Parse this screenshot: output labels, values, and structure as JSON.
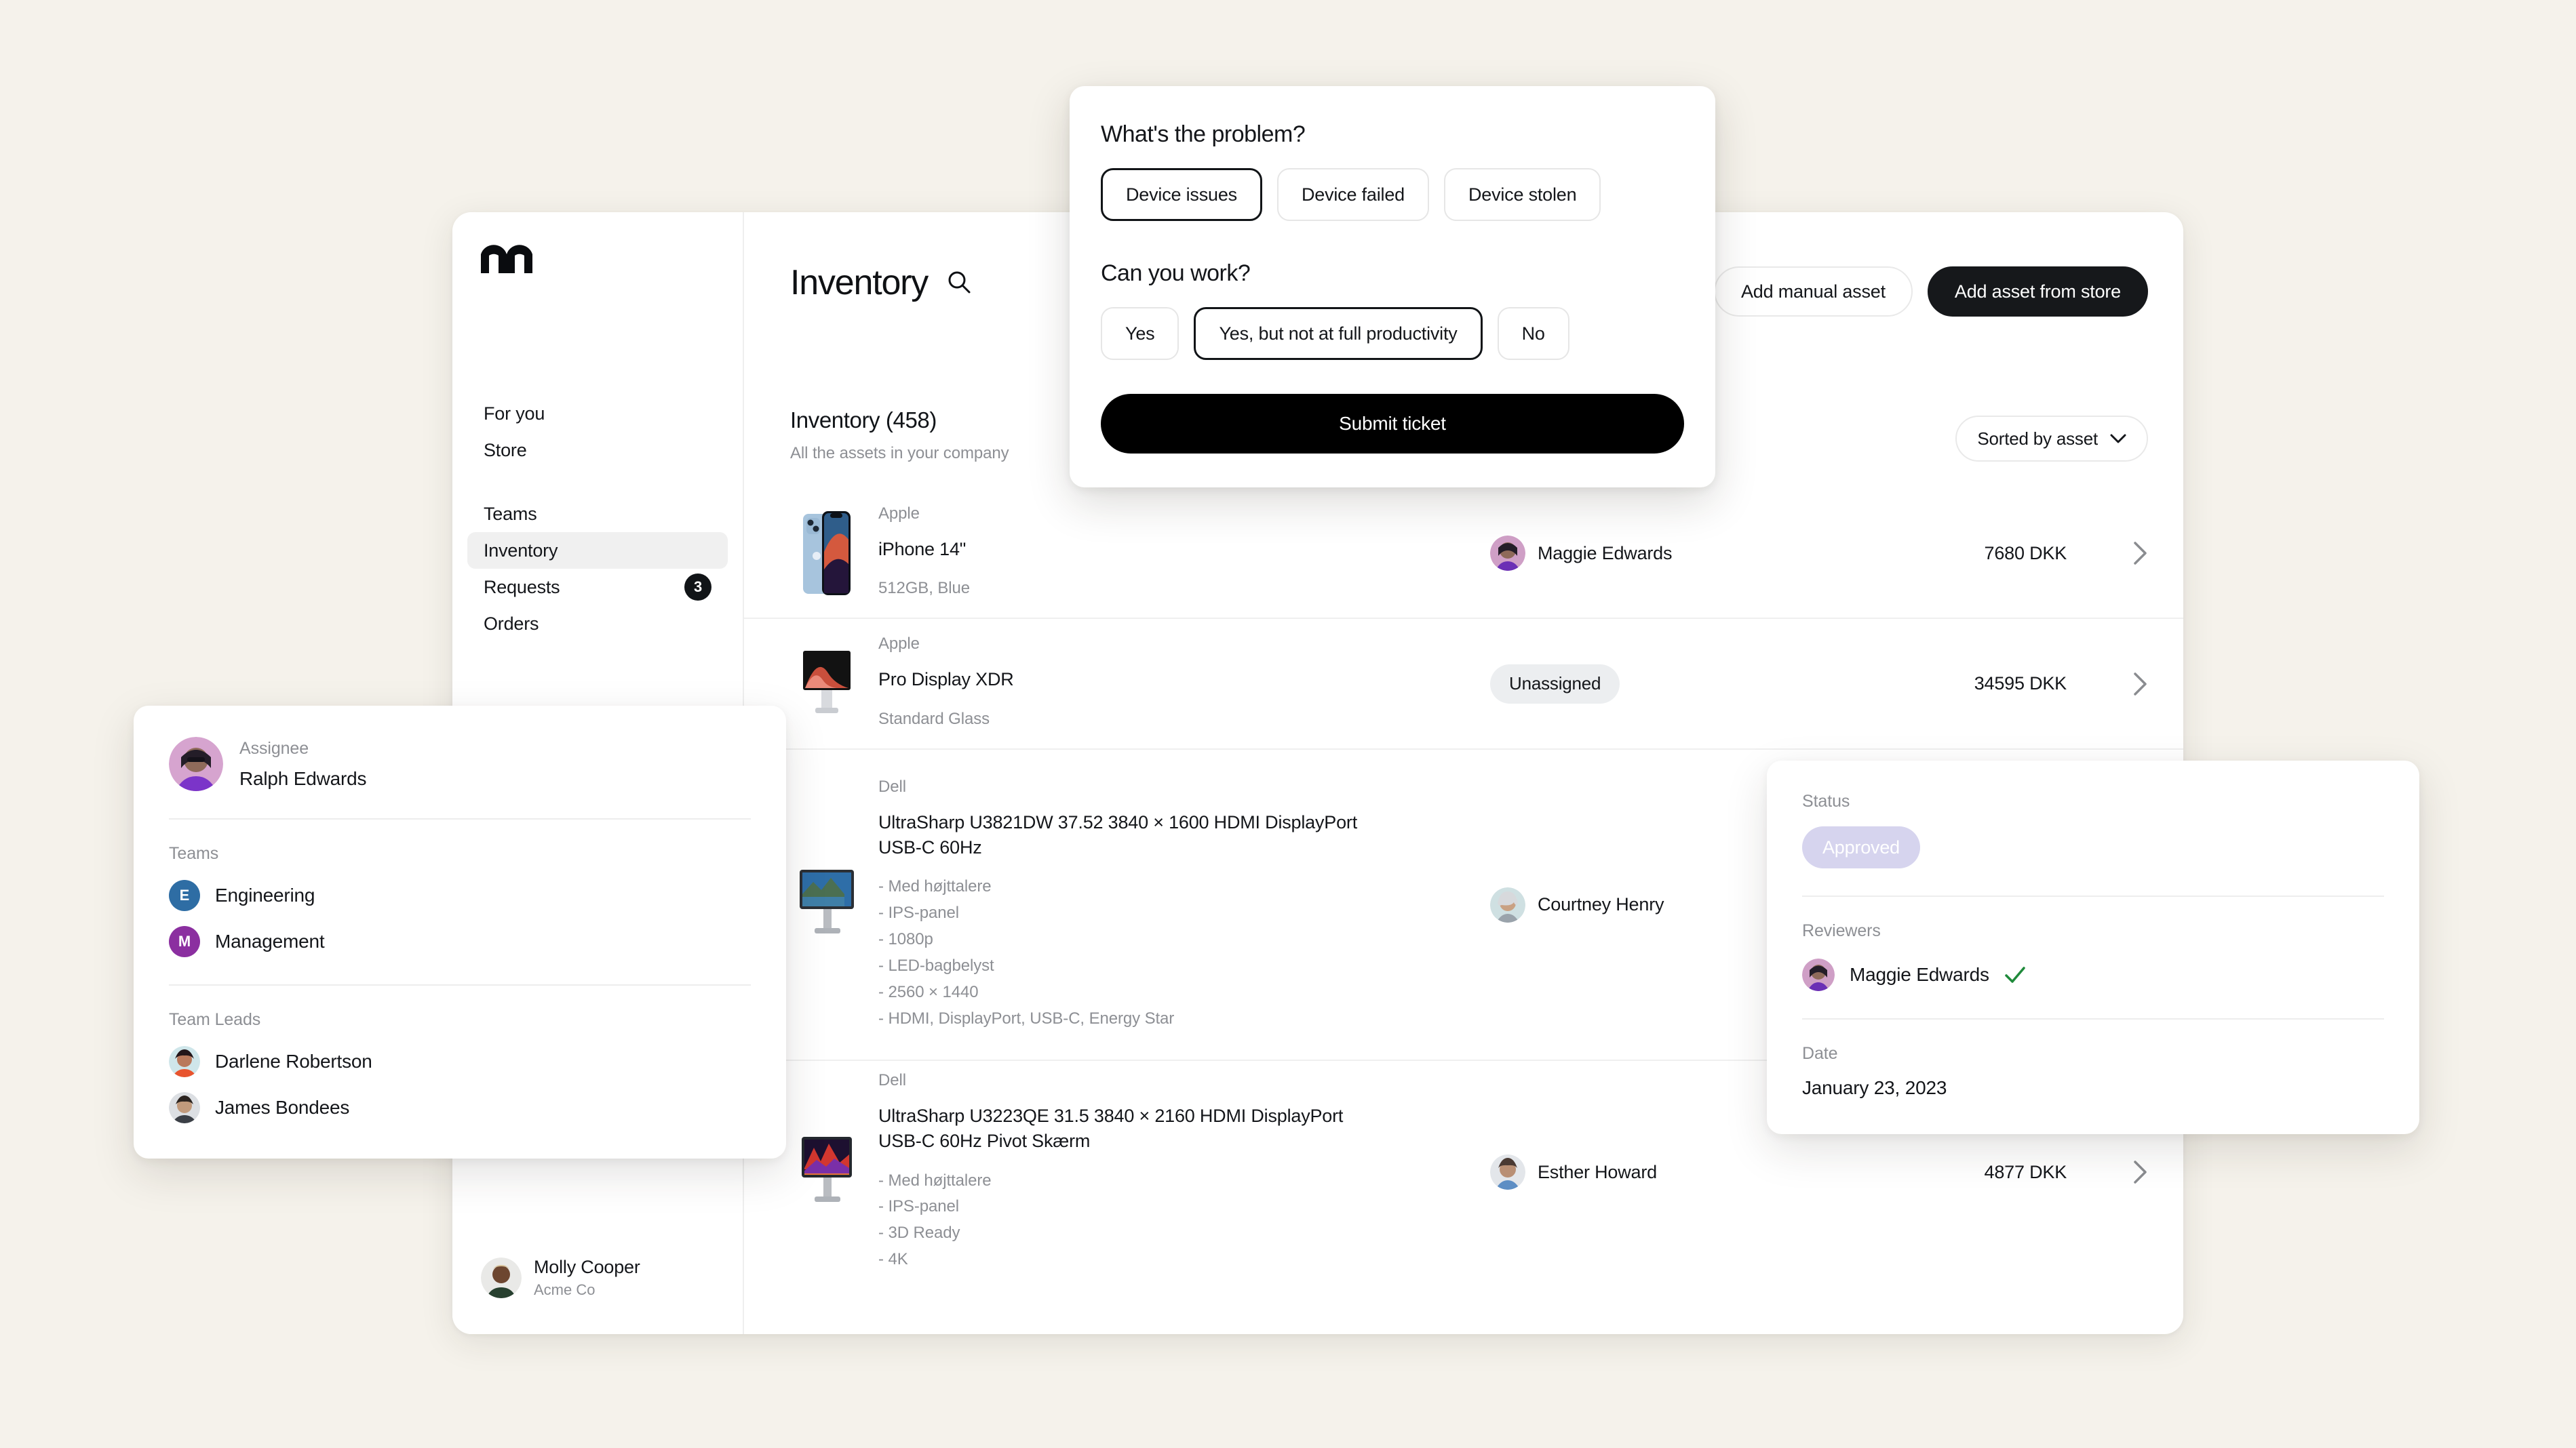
{
  "app": {
    "logo_icon": "m-logo-icon",
    "sidebar": {
      "items": [
        {
          "label": "For you",
          "selected": false,
          "badge": null
        },
        {
          "label": "Store",
          "selected": false,
          "badge": null
        },
        {
          "label": "Teams",
          "selected": false,
          "badge": null
        },
        {
          "label": "Inventory",
          "selected": true,
          "badge": null
        },
        {
          "label": "Requests",
          "selected": false,
          "badge": "3"
        },
        {
          "label": "Orders",
          "selected": false,
          "badge": null
        }
      ],
      "user": {
        "name": "Molly Cooper",
        "org": "Acme Co"
      }
    },
    "header": {
      "title": "Inventory",
      "search_icon": "search-icon",
      "actions": [
        {
          "label": "Add manual asset",
          "style": "ghost"
        },
        {
          "label": "Add asset from store",
          "style": "dark"
        }
      ]
    },
    "section": {
      "title": "Inventory (458)",
      "subtitle": "All the assets in your company",
      "sort_label": "Sorted by asset",
      "sort_icon": "chevron-down-icon"
    },
    "rows": [
      {
        "brand": "Apple",
        "name": "iPhone 14\"",
        "spec": "512GB, Blue",
        "assignee": "Maggie Edwards",
        "unassigned": false,
        "price": "7680 DKK",
        "chevron_icon": "chevron-right-icon"
      },
      {
        "brand": "Apple",
        "name": "Pro Display XDR",
        "spec": "Standard Glass",
        "assignee": "Unassigned",
        "unassigned": true,
        "price": "34595 DKK",
        "chevron_icon": "chevron-right-icon"
      },
      {
        "brand": "Dell",
        "name": "UltraSharp U3821DW 37.52 3840 × 1600 HDMI DisplayPort USB-C 60Hz",
        "spec": "- Med højttalere\n- IPS-panel\n- 1080p\n- LED-bagbelyst\n- 2560 × 1440\n- HDMI, DisplayPort, USB-C, Energy Star",
        "assignee": "Courtney Henry",
        "unassigned": false,
        "price": "",
        "chevron_icon": "chevron-right-icon"
      },
      {
        "brand": "Dell",
        "name": "UltraSharp U3223QE 31.5 3840 × 2160 HDMI DisplayPort USB-C 60Hz Pivot Skærm",
        "spec": "- Med højttalere\n- IPS-panel\n- 3D Ready\n- 4K",
        "assignee": "Esther Howard",
        "unassigned": false,
        "price": "4877 DKK",
        "chevron_icon": "chevron-right-icon"
      }
    ]
  },
  "modal": {
    "question_1": "What's the problem?",
    "options_1": [
      {
        "label": "Device issues",
        "selected": true
      },
      {
        "label": "Device failed",
        "selected": false
      },
      {
        "label": "Device stolen",
        "selected": false
      }
    ],
    "question_2": "Can you work?",
    "options_2": [
      {
        "label": "Yes",
        "selected": false
      },
      {
        "label": "Yes, but not at full productivity",
        "selected": true
      },
      {
        "label": "No",
        "selected": false
      }
    ],
    "submit_label": "Submit ticket"
  },
  "assignee_card": {
    "assignee_label": "Assignee",
    "assignee_name": "Ralph Edwards",
    "teams_label": "Teams",
    "teams": [
      {
        "name": "Engineering",
        "initial": "E",
        "color": "#2e6da4"
      },
      {
        "name": "Management",
        "initial": "M",
        "color": "#8b2fa0"
      }
    ],
    "leads_label": "Team Leads",
    "leads": [
      {
        "name": "Darlene Robertson"
      },
      {
        "name": "James Bondees"
      }
    ]
  },
  "status_card": {
    "status_label": "Status",
    "status_value": "Approved",
    "status_color": "#d6d4ee",
    "reviewers_label": "Reviewers",
    "reviewers": [
      {
        "name": "Maggie Edwards",
        "approved_icon": "check-icon"
      }
    ],
    "date_label": "Date",
    "date_value": "January 23, 2023"
  }
}
